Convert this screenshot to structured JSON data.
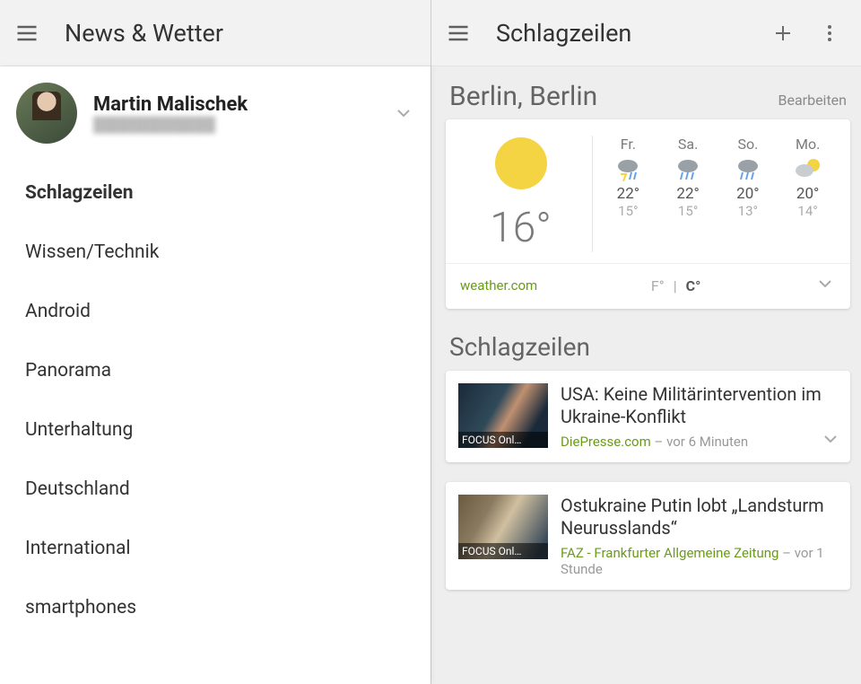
{
  "left": {
    "title": "News & Wetter",
    "account": {
      "name": "Martin Malischek",
      "email_blurred": "████████████"
    },
    "nav": [
      {
        "label": "Schlagzeilen",
        "active": true
      },
      {
        "label": "Wissen/Technik",
        "active": false
      },
      {
        "label": "Android",
        "active": false
      },
      {
        "label": "Panorama",
        "active": false
      },
      {
        "label": "Unterhaltung",
        "active": false
      },
      {
        "label": "Deutschland",
        "active": false
      },
      {
        "label": "International",
        "active": false
      },
      {
        "label": "smartphones",
        "active": false
      }
    ]
  },
  "right": {
    "title": "Schlagzeilen",
    "location": "Berlin, Berlin",
    "edit_label": "Bearbeiten",
    "weather": {
      "current_temp": "16°",
      "source": "weather.com",
      "unit_f": "F°",
      "unit_sep": "|",
      "unit_c": "C°",
      "forecast": [
        {
          "day": "Fr.",
          "icon": "storm",
          "hi": "22°",
          "lo": "15°"
        },
        {
          "day": "Sa.",
          "icon": "rain",
          "hi": "22°",
          "lo": "15°"
        },
        {
          "day": "So.",
          "icon": "rain",
          "hi": "20°",
          "lo": "13°"
        },
        {
          "day": "Mo.",
          "icon": "partly",
          "hi": "20°",
          "lo": "14°"
        }
      ]
    },
    "headlines_title": "Schlagzeilen",
    "news": [
      {
        "thumb_label": "FOCUS Onl…",
        "title": "USA: Keine Militärintervention im Ukraine-Konflikt",
        "source": "DiePresse.com",
        "time_prefix": " – ",
        "time": "vor 6 Minuten"
      },
      {
        "thumb_label": "FOCUS Onl…",
        "title": "Ostukraine Putin lobt „Landsturm Neurusslands“",
        "source": "FAZ - Frankfurter Allgemeine Zeitung",
        "time_prefix": " – ",
        "time": "vor 1 Stunde"
      }
    ]
  }
}
